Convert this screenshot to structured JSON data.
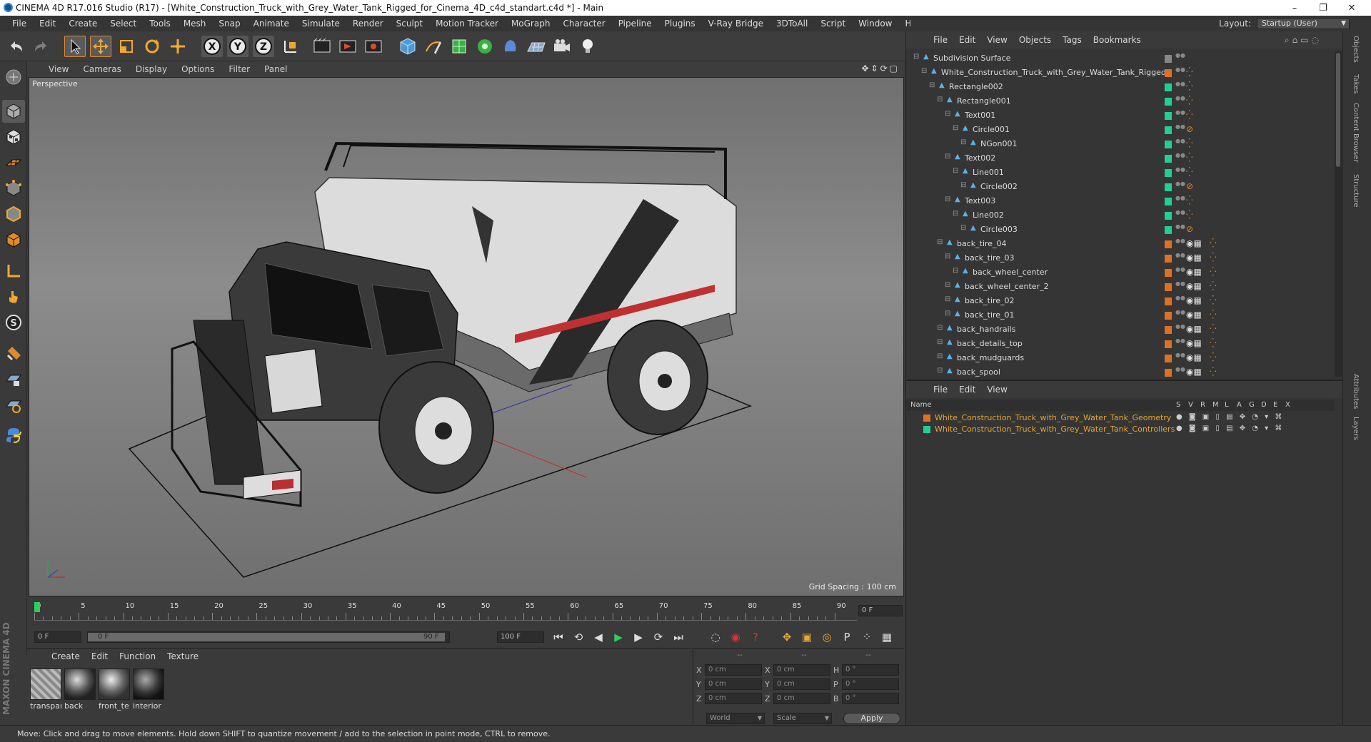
{
  "window": {
    "title": "CINEMA 4D R17.016 Studio (R17) - [White_Construction_Truck_with_Grey_Water_Tank_Rigged_for_Cinema_4D_c4d_standart.c4d *] - Main",
    "minimize": "–",
    "maximize": "❐",
    "close": "✕"
  },
  "menubar": [
    "File",
    "Edit",
    "Create",
    "Select",
    "Tools",
    "Mesh",
    "Snap",
    "Animate",
    "Simulate",
    "Render",
    "Sculpt",
    "Motion Tracker",
    "MoGraph",
    "Character",
    "Pipeline",
    "Plugins",
    "V-Ray Bridge",
    "3DToAll",
    "Script",
    "Window",
    "Help"
  ],
  "layout": {
    "label": "Layout:",
    "value": "Startup (User)"
  },
  "viewport": {
    "menu": [
      "View",
      "Cameras",
      "Display",
      "Options",
      "Filter",
      "Panel"
    ],
    "label": "Perspective",
    "grid_spacing": "Grid Spacing : 100 cm"
  },
  "timeline": {
    "ticks": [
      "0",
      "5",
      "10",
      "15",
      "20",
      "25",
      "30",
      "35",
      "40",
      "45",
      "50",
      "55",
      "60",
      "65",
      "70",
      "75",
      "80",
      "85",
      "90"
    ],
    "current_frame": "0 F",
    "start_field": "0 F",
    "range_start": "0 F",
    "range_end": "90 F",
    "end_field": "100 F"
  },
  "materials": {
    "menu": [
      "Create",
      "Edit",
      "Function",
      "Texture"
    ],
    "items": [
      {
        "name": "transpar",
        "icon": "transparent-material-icon"
      },
      {
        "name": "back",
        "icon": "back-material-icon"
      },
      {
        "name": "front_te",
        "icon": "front-material-icon"
      },
      {
        "name": "interior",
        "icon": "interior-material-icon"
      }
    ]
  },
  "coordinates": {
    "header": [
      "--",
      "--",
      "--"
    ],
    "rows": [
      {
        "a": "X",
        "av": "0 cm",
        "b": "X",
        "bv": "0 cm",
        "c": "H",
        "cv": "0 °"
      },
      {
        "a": "Y",
        "av": "0 cm",
        "b": "Y",
        "bv": "0 cm",
        "c": "P",
        "cv": "0 °"
      },
      {
        "a": "Z",
        "av": "0 cm",
        "b": "Z",
        "bv": "0 cm",
        "c": "B",
        "cv": "0 °"
      }
    ],
    "world": "World",
    "scale": "Scale",
    "apply": "Apply"
  },
  "objects": {
    "menu": [
      "File",
      "Edit",
      "View",
      "Objects",
      "Tags",
      "Bookmarks"
    ],
    "items": [
      {
        "name": "Subdivision Surface",
        "depth": 0,
        "color": "#888888"
      },
      {
        "name": "White_Construction_Truck_with_Grey_Water_Tank_Rigged",
        "depth": 1,
        "color": "#e07020"
      },
      {
        "name": "Rectangle002",
        "depth": 2,
        "color": "#20d090"
      },
      {
        "name": "Rectangle001",
        "depth": 3,
        "color": "#20d090"
      },
      {
        "name": "Text001",
        "depth": 4,
        "color": "#20d090"
      },
      {
        "name": "Circle001",
        "depth": 5,
        "color": "#20d090"
      },
      {
        "name": "NGon001",
        "depth": 6,
        "color": "#20d090"
      },
      {
        "name": "Text002",
        "depth": 4,
        "color": "#20d090"
      },
      {
        "name": "Line001",
        "depth": 5,
        "color": "#20d090"
      },
      {
        "name": "Circle002",
        "depth": 6,
        "color": "#20d090"
      },
      {
        "name": "Text003",
        "depth": 4,
        "color": "#20d090"
      },
      {
        "name": "Line002",
        "depth": 5,
        "color": "#20d090"
      },
      {
        "name": "Circle003",
        "depth": 6,
        "color": "#20d090"
      },
      {
        "name": "back_tire_04",
        "depth": 3,
        "color": "#e07020"
      },
      {
        "name": "back_tire_03",
        "depth": 4,
        "color": "#e07020"
      },
      {
        "name": "back_wheel_center",
        "depth": 5,
        "color": "#e07020"
      },
      {
        "name": "back_wheel_center_2",
        "depth": 4,
        "color": "#e07020"
      },
      {
        "name": "back_tire_02",
        "depth": 4,
        "color": "#e07020"
      },
      {
        "name": "back_tire_01",
        "depth": 4,
        "color": "#e07020"
      },
      {
        "name": "back_handrails",
        "depth": 3,
        "color": "#e07020"
      },
      {
        "name": "back_details_top",
        "depth": 3,
        "color": "#e07020"
      },
      {
        "name": "back_mudguards",
        "depth": 3,
        "color": "#e07020"
      },
      {
        "name": "back_spool",
        "depth": 3,
        "color": "#e07020"
      }
    ]
  },
  "layers": {
    "menu": [
      "File",
      "Edit",
      "View"
    ],
    "header": {
      "name": "Name",
      "cols": [
        "S",
        "V",
        "R",
        "M",
        "L",
        "A",
        "G",
        "D",
        "E",
        "X"
      ]
    },
    "items": [
      {
        "name": "White_Construction_Truck_with_Grey_Water_Tank_Geometry",
        "color": "#e07020"
      },
      {
        "name": "White_Construction_Truck_with_Grey_Water_Tank_Controllers",
        "color": "#20d090"
      }
    ]
  },
  "side_tabs": [
    "Objects",
    "Takes",
    "Content Browser",
    "Structure",
    "Attributes",
    "Layers"
  ],
  "status": "Move: Click and drag to move elements. Hold down SHIFT to quantize movement / add to the selection in point mode, CTRL to remove.",
  "brand": "MAXON CINEMA 4D"
}
